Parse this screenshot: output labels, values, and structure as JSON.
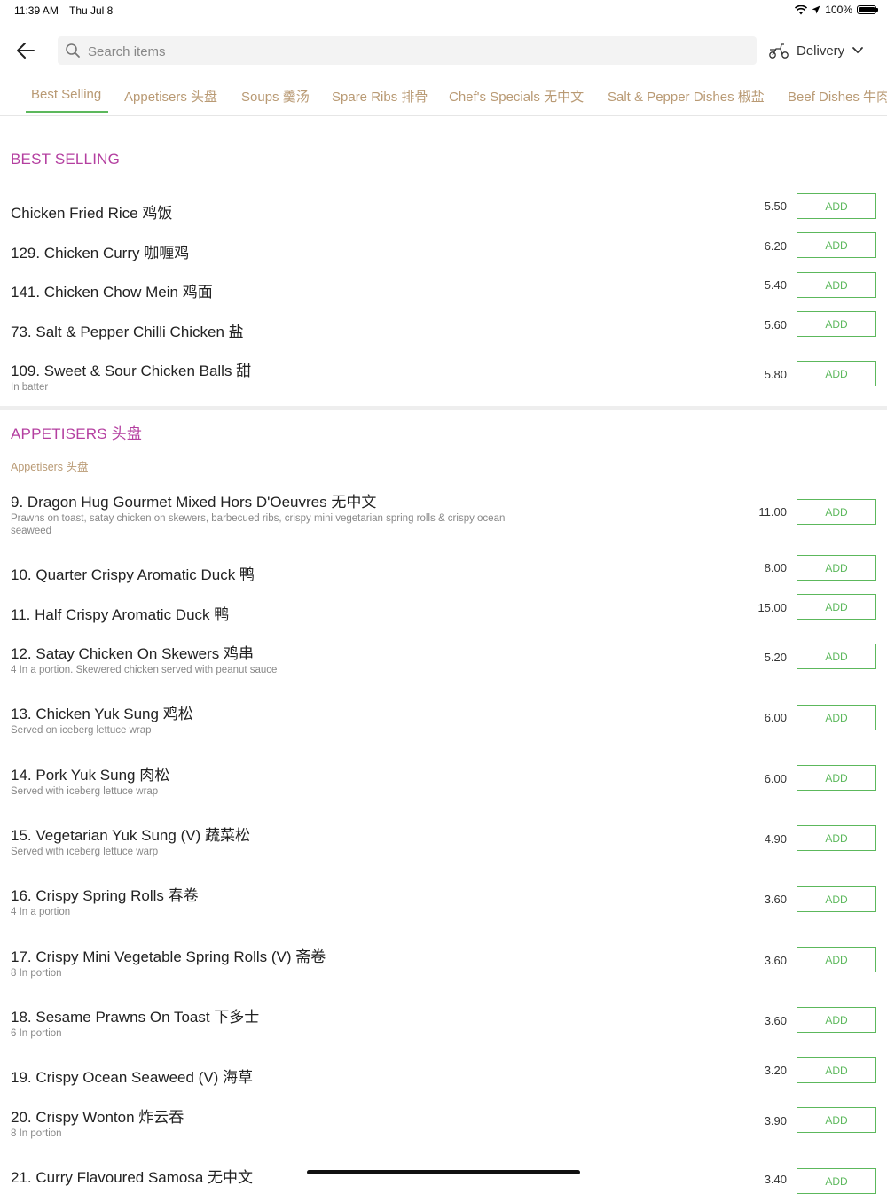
{
  "status": {
    "time": "11:39 AM",
    "date": "Thu Jul 8",
    "battery": "100%"
  },
  "header": {
    "search_placeholder": "Search items",
    "delivery_label": "Delivery"
  },
  "tabs": [
    {
      "label": "Best Selling"
    },
    {
      "label": "Appetisers 头盘"
    },
    {
      "label": "Soups 羹汤"
    },
    {
      "label": "Spare Ribs 排骨"
    },
    {
      "label": "Chef's Specials 无中文"
    },
    {
      "label": "Salt & Pepper Dishes 椒盐"
    },
    {
      "label": "Beef Dishes 牛肉"
    }
  ],
  "best_selling": {
    "title": "BEST SELLING",
    "items": [
      {
        "name": "Chicken Fried Rice 鸡饭",
        "price": "5.50"
      },
      {
        "name": "129. Chicken Curry 咖喱鸡",
        "price": "6.20"
      },
      {
        "name": "141. Chicken Chow Mein 鸡面",
        "price": "5.40"
      },
      {
        "name": "73. Salt & Pepper Chilli Chicken 盐",
        "price": "5.60"
      },
      {
        "name": "109. Sweet & Sour Chicken Balls 甜",
        "desc": "In batter",
        "price": "5.80"
      }
    ]
  },
  "appetisers": {
    "title": "APPETISERS 头盘",
    "subtitle": "Appetisers 头盘",
    "items": [
      {
        "name": "9. Dragon Hug Gourmet Mixed Hors D'Oeuvres 无中文",
        "desc": "Prawns on toast, satay chicken on skewers, barbecued ribs, crispy mini vegetarian spring rolls & crispy ocean seaweed",
        "price": "11.00"
      },
      {
        "name": "10. Quarter Crispy Aromatic Duck 鸭",
        "price": "8.00"
      },
      {
        "name": "11. Half Crispy Aromatic Duck 鸭",
        "price": "15.00"
      },
      {
        "name": "12. Satay Chicken On Skewers 鸡串",
        "desc": "4 In a portion. Skewered chicken served with peanut sauce",
        "price": "5.20"
      },
      {
        "name": "13. Chicken Yuk Sung 鸡松",
        "desc": "Served on iceberg lettuce wrap",
        "price": "6.00"
      },
      {
        "name": "14. Pork Yuk Sung 肉松",
        "desc": "Served with iceberg lettuce wrap",
        "price": "6.00"
      },
      {
        "name": "15. Vegetarian Yuk Sung (V) 蔬菜松",
        "desc": "Served with iceberg lettuce warp",
        "price": "4.90"
      },
      {
        "name": "16. Crispy Spring Rolls 春卷",
        "desc": "4 In a portion",
        "price": "3.60"
      },
      {
        "name": "17. Crispy Mini Vegetable Spring Rolls (V) 斋卷",
        "desc": "8 In portion",
        "price": "3.60"
      },
      {
        "name": "18. Sesame Prawns On Toast 下多士",
        "desc": "6 In portion",
        "price": "3.60"
      },
      {
        "name": "19. Crispy Ocean Seaweed (V) 海草",
        "price": "3.20"
      },
      {
        "name": "20. Crispy Wonton 炸云吞",
        "desc": "8 In portion",
        "price": "3.90"
      },
      {
        "name": "21. Curry Flavoured Samosa 无中文",
        "price": "3.40"
      }
    ]
  },
  "add_label": "ADD"
}
